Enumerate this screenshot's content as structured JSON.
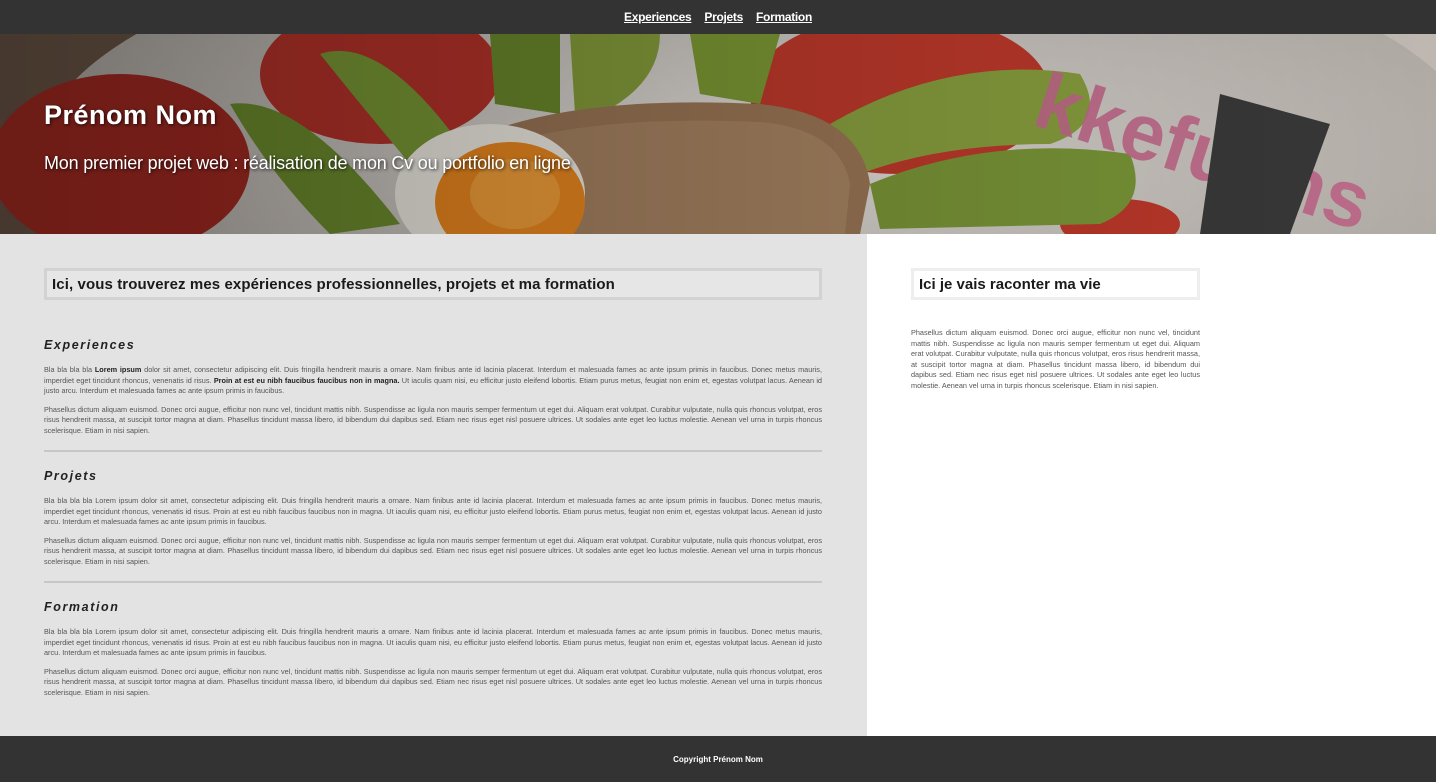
{
  "nav": {
    "items": [
      {
        "label": "Experiences"
      },
      {
        "label": "Projets"
      },
      {
        "label": "Formation"
      }
    ]
  },
  "hero": {
    "title": "Prénom Nom",
    "subtitle": "Mon premier projet web : réalisation de mon Cv ou portfolio en ligne"
  },
  "main": {
    "intro": "Ici, vous trouverez mes expériences professionnelles, projets et ma formation",
    "sections": [
      {
        "title": "Experiences",
        "p1_pre": "Bla bla bla bla ",
        "p1_bold1": "Lorem ipsum",
        "p1_mid": " dolor sit amet, consectetur adipiscing elit. Duis fringilla hendrerit mauris a ornare. Nam finibus ante id lacinia placerat. Interdum et malesuada fames ac ante ipsum primis in faucibus. Donec metus mauris, imperdiet eget tincidunt rhoncus, venenatis id risus. ",
        "p1_bold2": "Proin at est eu nibh faucibus faucibus non in magna.",
        "p1_post": " Ut iaculis quam nisi, eu efficitur justo eleifend lobortis. Etiam purus metus, feugiat non enim et, egestas volutpat lacus. Aenean id justo arcu. Interdum et malesuada fames ac ante ipsum primis in faucibus.",
        "p2": "Phasellus dictum aliquam euismod. Donec orci augue, efficitur non nunc vel, tincidunt mattis nibh. Suspendisse ac ligula non mauris semper fermentum ut eget dui. Aliquam erat volutpat. Curabitur vulputate, nulla quis rhoncus volutpat, eros risus hendrerit massa, at suscipit tortor magna at diam. Phasellus tincidunt massa libero, id bibendum dui dapibus sed. Etiam nec risus eget nisl posuere ultrices. Ut sodales ante eget leo luctus molestie. Aenean vel urna in turpis rhoncus scelerisque. Etiam in nisi sapien."
      },
      {
        "title": "Projets",
        "p1": "Bla bla bla bla Lorem ipsum dolor sit amet, consectetur adipiscing elit. Duis fringilla hendrerit mauris a ornare. Nam finibus ante id lacinia placerat. Interdum et malesuada fames ac ante ipsum primis in faucibus. Donec metus mauris, imperdiet eget tincidunt rhoncus, venenatis id risus. Proin at est eu nibh faucibus faucibus non in magna. Ut iaculis quam nisi, eu efficitur justo eleifend lobortis. Etiam purus metus, feugiat non enim et, egestas volutpat lacus. Aenean id justo arcu. Interdum et malesuada fames ac ante ipsum primis in faucibus.",
        "p2": "Phasellus dictum aliquam euismod. Donec orci augue, efficitur non nunc vel, tincidunt mattis nibh. Suspendisse ac ligula non mauris semper fermentum ut eget dui. Aliquam erat volutpat. Curabitur vulputate, nulla quis rhoncus volutpat, eros risus hendrerit massa, at suscipit tortor magna at diam. Phasellus tincidunt massa libero, id bibendum dui dapibus sed. Etiam nec risus eget nisl posuere ultrices. Ut sodales ante eget leo luctus molestie. Aenean vel urna in turpis rhoncus scelerisque. Etiam in nisi sapien."
      },
      {
        "title": "Formation",
        "p1": "Bla bla bla bla Lorem ipsum dolor sit amet, consectetur adipiscing elit. Duis fringilla hendrerit mauris a ornare. Nam finibus ante id lacinia placerat. Interdum et malesuada fames ac ante ipsum primis in faucibus. Donec metus mauris, imperdiet eget tincidunt rhoncus, venenatis id risus. Proin at est eu nibh faucibus faucibus non in magna. Ut iaculis quam nisi, eu efficitur justo eleifend lobortis. Etiam purus metus, feugiat non enim et, egestas volutpat lacus. Aenean id justo arcu. Interdum et malesuada fames ac ante ipsum primis in faucibus.",
        "p2": "Phasellus dictum aliquam euismod. Donec orci augue, efficitur non nunc vel, tincidunt mattis nibh. Suspendisse ac ligula non mauris semper fermentum ut eget dui. Aliquam erat volutpat. Curabitur vulputate, nulla quis rhoncus volutpat, eros risus hendrerit massa, at suscipit tortor magna at diam. Phasellus tincidunt massa libero, id bibendum dui dapibus sed. Etiam nec risus eget nisl posuere ultrices. Ut sodales ante eget leo luctus molestie. Aenean vel urna in turpis rhoncus scelerisque. Etiam in nisi sapien."
      }
    ]
  },
  "aside": {
    "title": "Ici je vais raconter ma vie",
    "text": "Phasellus dictum aliquam euismod. Donec orci augue, efficitur non nunc vel, tincidunt mattis nibh. Suspendisse ac ligula non mauris semper fermentum ut eget dui. Aliquam erat volutpat. Curabitur vulputate, nulla quis rhoncus volutpat, eros risus hendrerit massa, at suscipit tortor magna at diam. Phasellus tincidunt massa libero, id bibendum dui dapibus sed. Etiam nec risus eget nisl posuere ultrices. Ut sodales ante eget leo luctus molestie. Aenean vel urna in turpis rhoncus scelerisque. Etiam in nisi sapien."
  },
  "footer": {
    "copyright": "Copyright Prénom Nom"
  },
  "colors": {
    "nav_bg": "#333333",
    "main_bg": "#e3e3e3",
    "aside_bg": "#ffffff",
    "footer_bg": "#333333"
  }
}
